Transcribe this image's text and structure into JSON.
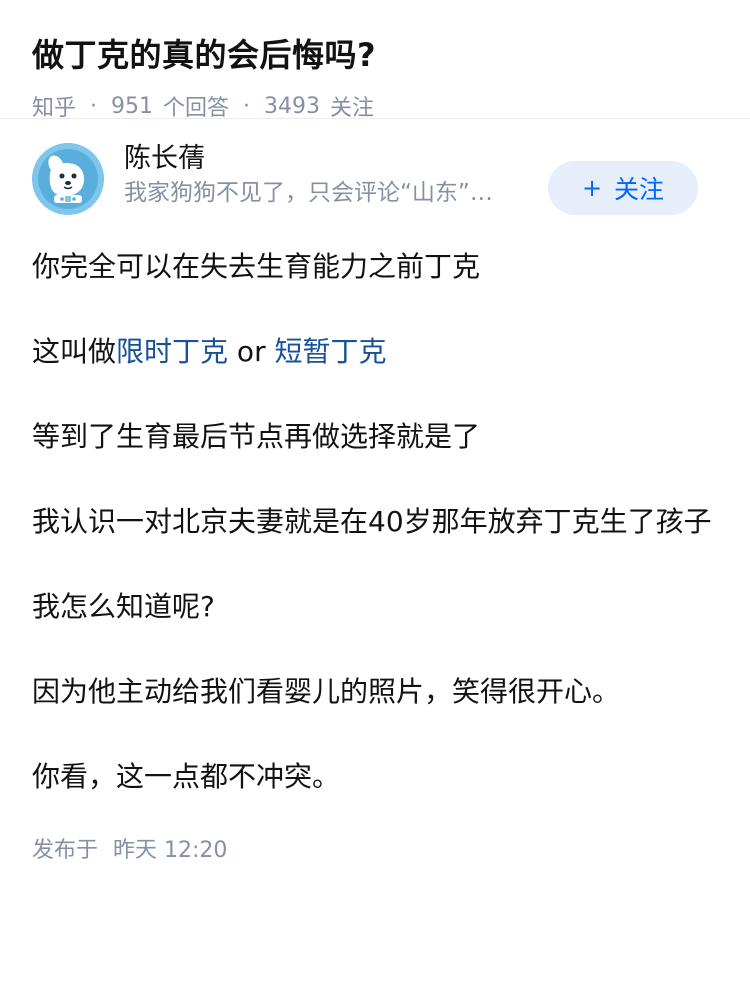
{
  "question": {
    "title": "做丁克的真的会后悔吗?",
    "source": "知乎",
    "answer_count": "951",
    "answer_label": "个回答",
    "follower_count": "3493",
    "follower_label": "关注"
  },
  "answer": {
    "author": {
      "name": "陈长蒨",
      "bio": "我家狗狗不见了，只会评论“山东”…",
      "follow_label": "关注",
      "follow_plus": "+"
    },
    "paragraphs": {
      "p1": "你完全可以在失去生育能力之前丁克",
      "p2_prefix": "这叫做",
      "p2_link1": "限时丁克",
      "p2_mid": " or ",
      "p2_link2": "短暂丁克",
      "p3": "等到了生育最后节点再做选择就是了",
      "p4": "我认识一对北京夫妻就是在40岁那年放弃丁克生了孩子",
      "p5": "我怎么知道呢?",
      "p6": "因为他主动给我们看婴儿的照片，笑得很开心。",
      "p7": "你看，这一点都不冲突。"
    },
    "published_label": "发布于",
    "published_time": "昨天 12:20"
  },
  "colors": {
    "link": "#175199",
    "meta": "#8590a6",
    "accent": "#0066ff",
    "follow_bg": "#e5eefa",
    "avatar_bg": "#7fc6ec"
  },
  "icons": {
    "avatar": "cartoon-dog-avatar"
  }
}
